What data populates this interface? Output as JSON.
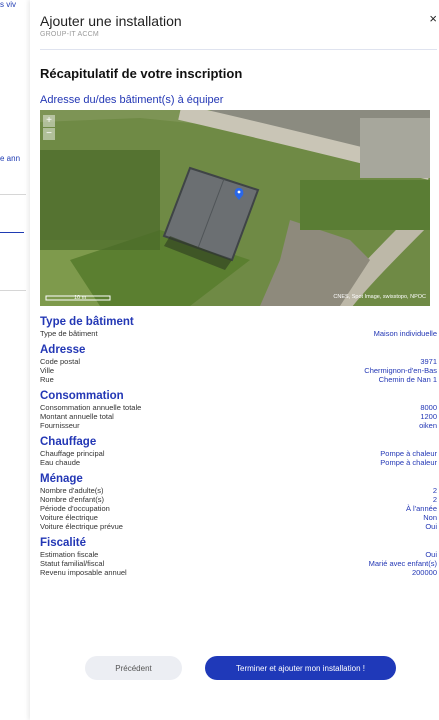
{
  "background": {
    "top_text": "s viv",
    "mid_text": "e ann"
  },
  "modal": {
    "title": "Ajouter une installation",
    "subtitle": "GROUP-IT ACCM",
    "close_label": "×"
  },
  "summary": {
    "title": "Récapitulatif de votre inscription",
    "map_title": "Adresse du/des bâtiment(s) à équiper",
    "map": {
      "zoom_in": "+",
      "zoom_out": "−",
      "scale_label": "10 m",
      "attribution": "CNES, Spot Image, swisstopo, NPOC"
    }
  },
  "sections": [
    {
      "title": "Type de bâtiment",
      "rows": [
        {
          "label": "Type de bâtiment",
          "value": "Maison individuelle"
        }
      ]
    },
    {
      "title": "Adresse",
      "rows": [
        {
          "label": "Code postal",
          "value": "3971"
        },
        {
          "label": "Ville",
          "value": "Chermignon-d'en-Bas"
        },
        {
          "label": "Rue",
          "value": "Chemin de Nan 1"
        }
      ]
    },
    {
      "title": "Consommation",
      "rows": [
        {
          "label": "Consommation annuelle totale",
          "value": "8000"
        },
        {
          "label": "Montant annuelle total",
          "value": "1200"
        },
        {
          "label": "Fournisseur",
          "value": "oiken"
        }
      ]
    },
    {
      "title": "Chauffage",
      "rows": [
        {
          "label": "Chauffage principal",
          "value": "Pompe à chaleur"
        },
        {
          "label": "Eau chaude",
          "value": "Pompe à chaleur"
        }
      ]
    },
    {
      "title": "Ménage",
      "rows": [
        {
          "label": "Nombre d'adulte(s)",
          "value": "2"
        },
        {
          "label": "Nombre d'enfant(s)",
          "value": "2"
        },
        {
          "label": "Période d'occupation",
          "value": "À l'année"
        },
        {
          "label": "Voiture électrique",
          "value": "Non"
        },
        {
          "label": "Voiture électrique prévue",
          "value": "Oui"
        }
      ]
    },
    {
      "title": "Fiscalité",
      "rows": [
        {
          "label": "Estimation fiscale",
          "value": "Oui"
        },
        {
          "label": "Statut familial/fiscal",
          "value": "Marié avec enfant(s)"
        },
        {
          "label": "Revenu imposable annuel",
          "value": "200000"
        }
      ]
    }
  ],
  "buttons": {
    "previous": "Précédent",
    "finish": "Terminer et ajouter mon installation !"
  },
  "colors": {
    "accent": "#2337b5",
    "primary_button": "#1f39b9",
    "secondary_button": "#eceef3"
  }
}
